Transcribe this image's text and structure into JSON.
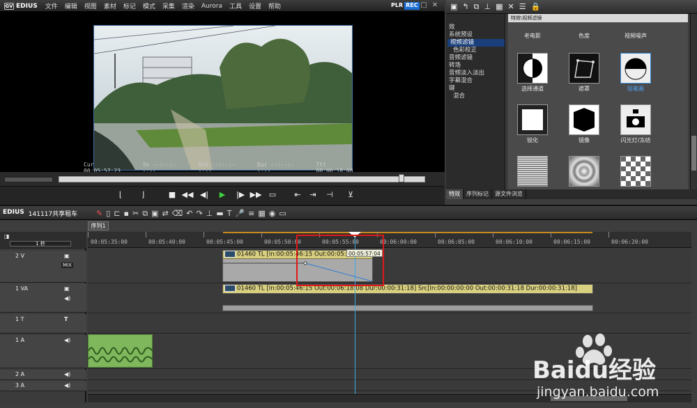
{
  "app": {
    "name": "EDIUS",
    "menu": [
      "文件",
      "编辑",
      "视图",
      "素材",
      "标记",
      "模式",
      "采集",
      "渲染",
      "Aurora",
      "工具",
      "设置",
      "帮助"
    ],
    "plr": "PLR",
    "rec": "REC"
  },
  "player": {
    "timecodes": [
      {
        "label": "Cur",
        "value": "00:05:57:23"
      },
      {
        "label": "In",
        "value": "--:--:--:--"
      },
      {
        "label": "Out",
        "value": "--:--:--:--"
      },
      {
        "label": "Dur",
        "value": "--:--:--:--"
      },
      {
        "label": "Ttl",
        "value": "00:06:18:08"
      }
    ],
    "scrub_position": 0.93
  },
  "effects": {
    "tree": [
      "效",
      "系统预设",
      "视频滤镜",
      "色彩校正",
      "音频滤镜",
      "转场",
      "音频淡入淡出",
      "字幕混合",
      "键",
      "混合"
    ],
    "tree_selected": "视频滤镜",
    "path": "特效\\视频滤镜",
    "row0": [
      "老电影",
      "色度",
      "视频噪声"
    ],
    "row1": [
      "选择通道",
      "遮罩",
      "铅笔画"
    ],
    "row2": [
      "锐化",
      "镜像",
      "闪光灯/冻结"
    ],
    "selected": "铅笔画",
    "tabs": [
      "特效",
      "序列标记",
      "源文件浏览"
    ]
  },
  "timeline": {
    "project_label": "EDIUS",
    "project_name": "141117共享租车",
    "sequence_tab": "序列1",
    "scale_label": "1 秒",
    "ruler": [
      "00:05:35:00",
      "00:05:40:00",
      "00:05:45:00",
      "00:05:50:00",
      "00:05:55:00",
      "00:06:00:00",
      "00:06:05:00",
      "00:06:10:00",
      "00:06:15:00",
      "00:06:20:00"
    ],
    "tracks": [
      {
        "name": "2 V",
        "type": "V"
      },
      {
        "name": "1 VA",
        "type": "VA"
      },
      {
        "name": "1 T",
        "type": "T"
      },
      {
        "name": "1 A",
        "type": "A"
      },
      {
        "name": "2 A",
        "type": "A"
      },
      {
        "name": "3 A",
        "type": "A"
      }
    ],
    "clip_v2": "01460  TL [In:00:05:46:15 Out:00:05:5",
    "clip_va": "01460  TL [In:00:05:46:15 Out:00:06:18:08 Dur:00:00:31:18]  Src[In:00:00:00:00 Out:00:00:31:18 Dur:00:00:31:18]",
    "tooltip": "00:05:57:04",
    "mix_label": "MIX"
  },
  "watermark": {
    "brand": "Baidu经验",
    "url": "jingyan.baidu.com"
  },
  "colors": {
    "accent": "#1a6fd6",
    "highlight": "#e01818",
    "playhead": "#3fa7e0",
    "clip": "#d9d080"
  }
}
